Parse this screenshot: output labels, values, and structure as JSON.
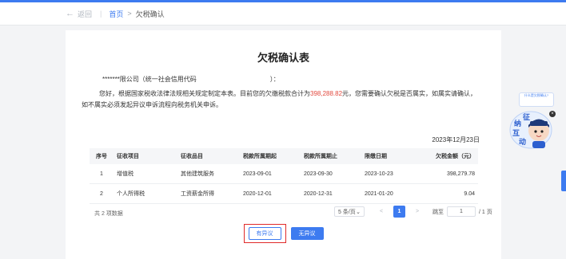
{
  "breadcrumb": {
    "back_label": "返回",
    "home_label": "首页",
    "separator": ">",
    "current_label": "欠税确认"
  },
  "doc": {
    "title": "欠税确认表",
    "greeting_company": "*******限公司（统一社会信用代码",
    "greeting_close": "）：",
    "para_before": "您好，根据国家税收法律法规相关规定制定本表。目前您的欠缴税款合计为",
    "amount": "398,288.82",
    "para_after": "元，您需要确认欠税是否属实，如属实请确认，如不属实必须发起异议申诉流程向税务机关申诉。",
    "date": "2023年12月23日"
  },
  "table": {
    "headers": [
      "序号",
      "征收项目",
      "征收品目",
      "税款所属期起",
      "税款所属期止",
      "限缴日期",
      "欠税金额（元）"
    ],
    "rows": [
      [
        "1",
        "增值税",
        "其他建筑服务",
        "2023-09-01",
        "2023-09-30",
        "2023-10-23",
        "398,279.78"
      ],
      [
        "2",
        "个人所得税",
        "工资薪金所得",
        "2020-12-01",
        "2020-12-31",
        "2021-01-20",
        "9.04"
      ]
    ]
  },
  "pagination": {
    "total_label": "共 2 项数据",
    "page_size": "5 条/页",
    "prev": "<",
    "current_page": "1",
    "next": ">",
    "jump_label": "跳至",
    "jump_value": "1",
    "total_pages": "/ 1 页"
  },
  "actions": {
    "dispute_label": "有异议",
    "no_dispute_label": "无异议"
  },
  "side_widget": {
    "chat_text": "什么是欠税确认?",
    "mascot_text": "征纳互动",
    "close": "×"
  },
  "colors": {
    "accent": "#3d7bf0",
    "amount": "#e2483d",
    "highlight": "#e02a2a"
  }
}
